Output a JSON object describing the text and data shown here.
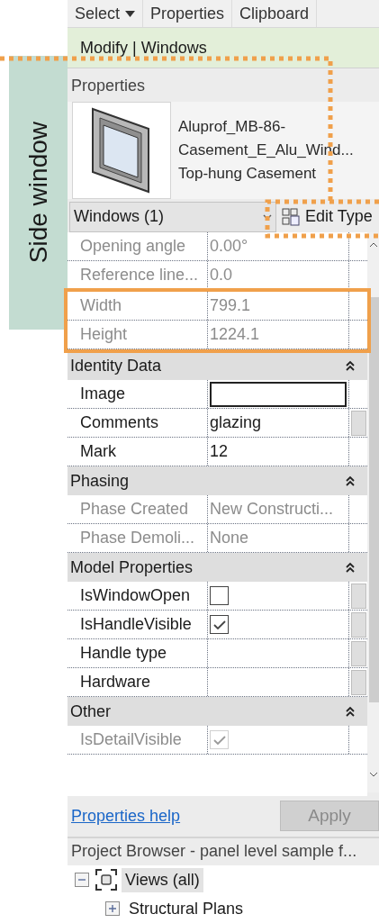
{
  "annotation": {
    "label": "Side window"
  },
  "ribbon": {
    "tabs": [
      {
        "label": "Select",
        "has_menu": true
      },
      {
        "label": "Properties",
        "has_menu": false
      },
      {
        "label": "Clipboard",
        "has_menu": false
      }
    ],
    "context_tab": "Modify | Windows"
  },
  "properties": {
    "title": "Properties",
    "type_selector": {
      "lines": [
        "Aluprof_MB-86-",
        "Casement_E_Alu_Wind...",
        "Top-hung Casement"
      ]
    },
    "instance_filter": "Windows (1)",
    "edit_type": "Edit Type",
    "sections": [
      {
        "rows": [
          {
            "name": "Opening angle",
            "kind": "text",
            "value": "0.00°",
            "disabled": true,
            "highlighted": false,
            "edit_button": false
          },
          {
            "name": "Reference line...",
            "kind": "text",
            "value": "0.0",
            "disabled": true,
            "highlighted": false,
            "edit_button": false
          },
          {
            "name": "Width",
            "kind": "text",
            "value": "799.1",
            "disabled": true,
            "highlighted": true,
            "edit_button": false
          },
          {
            "name": "Height",
            "kind": "text",
            "value": "1224.1",
            "disabled": true,
            "highlighted": true,
            "edit_button": false
          }
        ]
      },
      {
        "header": "Identity Data",
        "expanded": true,
        "rows": [
          {
            "name": "Image",
            "kind": "field",
            "disabled": false,
            "highlighted": false,
            "edit_button": false
          },
          {
            "name": "Comments",
            "kind": "text",
            "value": "glazing",
            "disabled": false,
            "highlighted": false,
            "edit_button": true
          },
          {
            "name": "Mark",
            "kind": "text",
            "value": "12",
            "disabled": false,
            "highlighted": false,
            "edit_button": false
          }
        ]
      },
      {
        "header": "Phasing",
        "expanded": true,
        "rows": [
          {
            "name": "Phase Created",
            "kind": "text",
            "value": "New Constructi...",
            "disabled": true,
            "highlighted": false,
            "edit_button": false
          },
          {
            "name": "Phase Demoli...",
            "kind": "text",
            "value": "None",
            "disabled": true,
            "highlighted": false,
            "edit_button": false
          }
        ]
      },
      {
        "header": "Model Properties",
        "expanded": true,
        "rows": [
          {
            "name": "IsWindowOpen",
            "kind": "checkbox",
            "checked": false,
            "disabled": false,
            "highlighted": false,
            "edit_button": true
          },
          {
            "name": "IsHandleVisible",
            "kind": "checkbox",
            "checked": true,
            "disabled": false,
            "highlighted": false,
            "edit_button": true
          },
          {
            "name": "Handle type",
            "kind": "text",
            "disabled": false,
            "highlighted": false,
            "edit_button": true
          },
          {
            "name": "Hardware",
            "kind": "text",
            "disabled": false,
            "highlighted": false,
            "edit_button": true
          }
        ]
      },
      {
        "header": "Other",
        "expanded": true,
        "rows": [
          {
            "name": "IsDetailVisible",
            "kind": "checkbox",
            "checked": true,
            "disabled": true,
            "highlighted": false,
            "edit_button": false
          }
        ]
      }
    ],
    "help_link": "Properties help",
    "apply": {
      "label": "Apply",
      "disabled": true
    }
  },
  "project_browser": {
    "title": "Project Browser - panel level sample f...",
    "tree": [
      {
        "label": "Views (all)",
        "expanded": true,
        "selected": true,
        "children": [
          {
            "label": "Structural Plans",
            "expanded": false,
            "selected": false
          }
        ]
      }
    ]
  }
}
